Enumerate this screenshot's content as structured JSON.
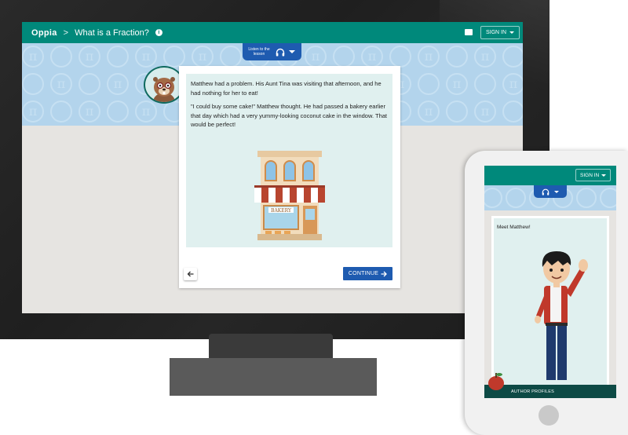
{
  "desktop": {
    "app_logo": "Oppia",
    "breadcrumb_separator": ">",
    "lesson_title": "What is a Fraction?",
    "sign_in_label": "SIGN IN",
    "audio": {
      "label": "Listen to the lesson"
    },
    "card": {
      "paragraphs": [
        "Matthew had a problem. His Aunt Tina was visiting that afternoon, and he had nothing for her to eat!",
        "\"I could buy some cake!\" Matthew thought. He had passed a bakery earlier that day which had a very yummy-looking coconut cake in the window. That would be perfect!"
      ],
      "bakery_sign": "BAKERY",
      "continue_label": "CONTINUE"
    }
  },
  "mobile": {
    "sign_in_label": "SIGN IN",
    "card_text": "Meet Matthew!",
    "footer_label": "AUTHOR PROFILES"
  },
  "colors": {
    "brand_teal": "#00897b",
    "primary_blue": "#1e5bb0",
    "pattern_blue": "#b3d4ec",
    "card_bg": "#e0f0ef"
  },
  "icons": [
    "info-icon",
    "feedback-icon",
    "caret-down-icon",
    "headphones-icon",
    "back-arrow-icon",
    "forward-arrow-icon"
  ]
}
